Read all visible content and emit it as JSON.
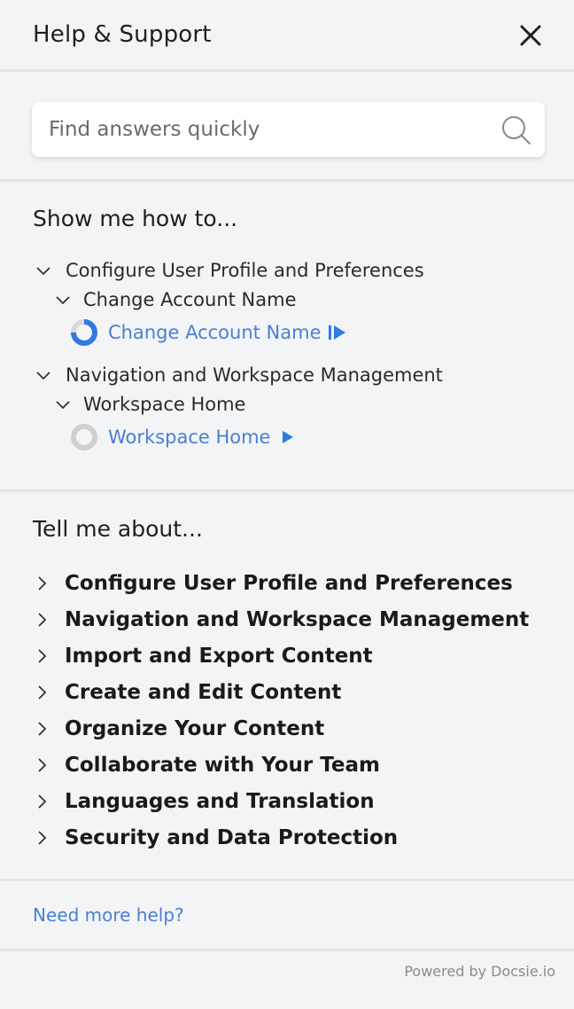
{
  "header": {
    "title": "Help & Support"
  },
  "search": {
    "placeholder": "Find answers quickly"
  },
  "howto": {
    "title": "Show me how to...",
    "groups": [
      {
        "label": "Configure User Profile and Preferences",
        "subgroup": "Change Account Name",
        "link": "Change Account Name",
        "progress": 0.75,
        "progress_color": "#2f7ae5"
      },
      {
        "label": "Navigation and Workspace Management",
        "subgroup": "Workspace Home",
        "link": "Workspace Home",
        "progress": 0,
        "progress_color": "#cfcfcf"
      }
    ]
  },
  "about": {
    "title": "Tell me about...",
    "items": [
      "Configure User Profile and Preferences",
      "Navigation and Workspace Management",
      "Import and Export Content",
      "Create and Edit Content",
      "Organize Your Content",
      "Collaborate with Your Team",
      "Languages and Translation",
      "Security and Data Protection"
    ]
  },
  "footer": {
    "help_link": "Need more help?",
    "powered_by": "Powered by Docsie.io"
  },
  "colors": {
    "accent": "#2f7ae5",
    "link": "#4a7fd4",
    "background": "#f3f4f6"
  }
}
